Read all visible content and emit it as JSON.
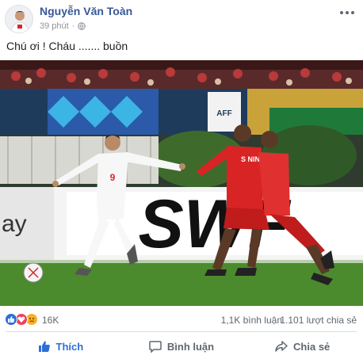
{
  "post": {
    "author": "Nguyễn Văn Toàn",
    "time": "39 phút",
    "text": "Chú ơi ! Cháu ....... buồn"
  },
  "photo": {
    "jersey_number_white": "9",
    "board_text": "SWF",
    "board_left_text": "ay",
    "red_player_name": "S NIN"
  },
  "stats": {
    "reaction_count": "16K",
    "comments": "1,1K bình luận",
    "shares": "1.101 lượt chia sẻ",
    "reaction_icons": [
      "like-icon",
      "love-icon",
      "sad-icon"
    ]
  },
  "actions": {
    "like": "Thích",
    "comment": "Bình luận",
    "share": "Chia sẻ"
  },
  "colors": {
    "author_link": "#385898",
    "like_blue": "#2d6fd6",
    "love_red": "#f33e58",
    "sad_yellow": "#f7b125"
  }
}
